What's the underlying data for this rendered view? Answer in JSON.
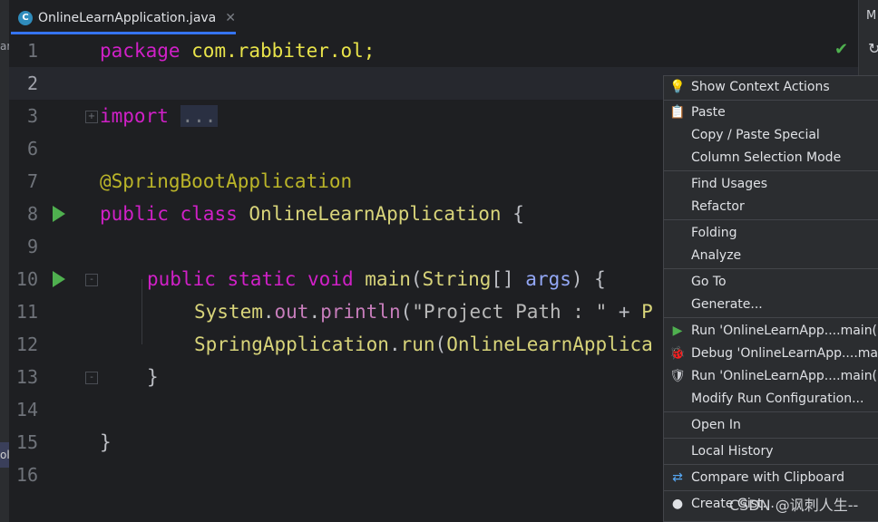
{
  "left_strip": {
    "frag_top": "ar",
    "frag_bottom": "oli"
  },
  "tab": {
    "icon_letter": "C",
    "title": "OnlineLearnApplication.java",
    "close_glyph": "✕"
  },
  "right_strip": {
    "label": "M",
    "sync_glyph": "↻"
  },
  "editor": {
    "check_glyph": "✔",
    "line_numbers": [
      "1",
      "2",
      "3",
      "6",
      "7",
      "8",
      "9",
      "10",
      "11",
      "12",
      "13",
      "14",
      "15",
      "16"
    ]
  },
  "code": {
    "l1_kw": "package",
    "l1_rest": " com.rabbiter.ol;",
    "l3_kw": "import",
    "l3_fold": "...",
    "l7_ann": "@SpringBootApplication",
    "l8_kw1": "public",
    "l8_kw2": "class",
    "l8_cls": "OnlineLearnApplication",
    "l8_rest": " {",
    "l10_kw1": "public",
    "l10_kw2": "static",
    "l10_kw3": "void",
    "l10_fn": "main",
    "l10_p1": "(",
    "l10_type": "String",
    "l10_p2": "[] ",
    "l10_param": "args",
    "l10_p3": ") {",
    "l11_cls": "System",
    "l11_dot": ".",
    "l11_fld": "out",
    "l11_dot2": ".",
    "l11_fn": "println",
    "l11_p": "(",
    "l11_str": "\"Project Path : \"",
    "l11_rest": " + ",
    "l11_tail": "P",
    "l12_cls": "SpringApplication",
    "l12_dot": ".",
    "l12_fn": "run",
    "l12_p": "(",
    "l12_arg": "OnlineLearnApplica",
    "l13": "}",
    "l15": "}"
  },
  "context_menu": {
    "items": [
      {
        "label": "Show Context Actions",
        "icon": "lightbulb-icon"
      },
      {
        "label": "Paste",
        "icon": "clipboard-icon"
      },
      {
        "label": "Copy / Paste Special",
        "icon": ""
      },
      {
        "label": "Column Selection Mode",
        "icon": ""
      },
      {
        "label": "Find Usages",
        "icon": ""
      },
      {
        "label": "Refactor",
        "icon": ""
      },
      {
        "label": "Folding",
        "icon": ""
      },
      {
        "label": "Analyze",
        "icon": ""
      },
      {
        "label": "Go To",
        "icon": ""
      },
      {
        "label": "Generate...",
        "icon": ""
      },
      {
        "label": "Run 'OnlineLearnApp....main()'",
        "icon": "run-icon"
      },
      {
        "label": "Debug 'OnlineLearnApp....main()'",
        "icon": "debug-icon"
      },
      {
        "label": "Run 'OnlineLearnApp....main()' with Coverage",
        "icon": "coverage-icon"
      },
      {
        "label": "Modify Run Configuration...",
        "icon": ""
      },
      {
        "label": "Open In",
        "icon": ""
      },
      {
        "label": "Local History",
        "icon": ""
      },
      {
        "label": "Compare with Clipboard",
        "icon": "compare-icon"
      },
      {
        "label": "Create Gist...",
        "icon": "github-icon"
      }
    ]
  },
  "watermark": "CSDN @讽刺人生--",
  "colors": {
    "run_green": "#4fb04f",
    "accent_blue": "#3574f0"
  }
}
